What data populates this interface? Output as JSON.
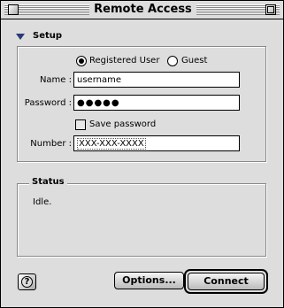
{
  "window": {
    "title": "Remote Access"
  },
  "setup": {
    "label": "Setup",
    "radio_registered": "Registered User",
    "radio_guest": "Guest",
    "selected": "Registered User",
    "name_label": "Name :",
    "name_value": "username",
    "password_label": "Password :",
    "password_value": "●●●●●",
    "save_password_label": "Save password",
    "save_password_checked": false,
    "number_label": "Number :",
    "number_value": "XXX-XXX-XXXX"
  },
  "status": {
    "label": "Status",
    "text": "Idle."
  },
  "buttons": {
    "help": "?",
    "options": "Options...",
    "connect": "Connect"
  }
}
